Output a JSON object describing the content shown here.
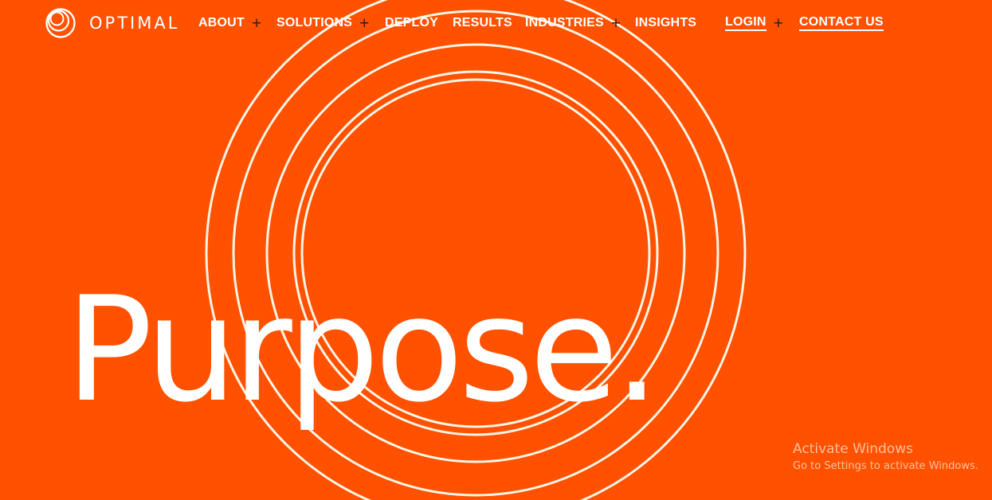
{
  "brand": {
    "name": "OPTIMAL",
    "logo_icon": "concentric-rings-logo-icon"
  },
  "nav": {
    "items": [
      {
        "label": "ABOUT",
        "has_submenu": true
      },
      {
        "label": "SOLUTIONS",
        "has_submenu": true
      },
      {
        "label": "DEPLOY",
        "has_submenu": false
      },
      {
        "label": "RESULTS",
        "has_submenu": false
      },
      {
        "label": "INDUSTRIES",
        "has_submenu": true
      },
      {
        "label": "INSIGHTS",
        "has_submenu": false
      }
    ],
    "login_label": "LOGIN",
    "contact_label": "CONTACT US",
    "expand_icon": "+"
  },
  "hero": {
    "headline": "Purpose."
  },
  "windows_watermark": {
    "title": "Activate Windows",
    "subtitle": "Go to Settings to activate Windows."
  },
  "colors": {
    "background": "#ff5100",
    "text": "#ffffff",
    "ring_stroke": "#fff5e6",
    "plus_icon": "#3a1a10"
  }
}
